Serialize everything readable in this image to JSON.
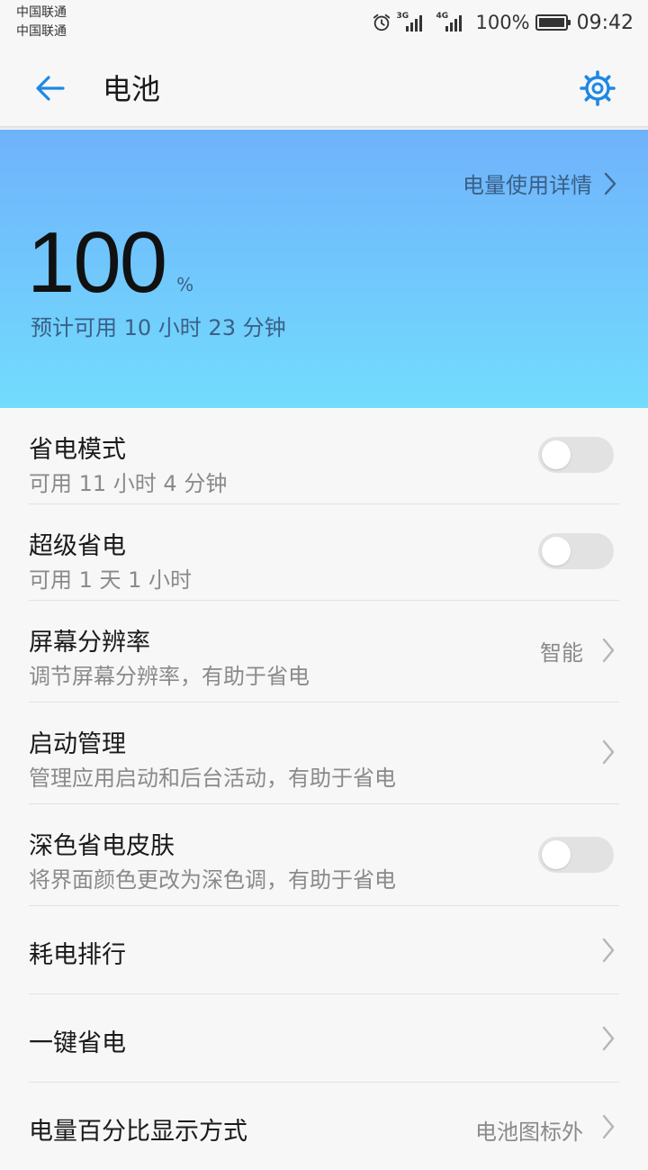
{
  "status_bar": {
    "carrier1": "中国联通",
    "carrier2": "中国联通",
    "alarm_icon": "alarm-clock-icon",
    "network1": "3G",
    "network2": "4G",
    "battery_percent": "100%",
    "battery_level": 1.0,
    "time": "09:42"
  },
  "header": {
    "title": "电池",
    "back_icon": "arrow-left-icon",
    "settings_icon": "gear-icon"
  },
  "hero": {
    "usage_link": "电量使用详情",
    "level": "100",
    "unit": "%",
    "estimate": "预计可用 10 小时 23 分钟",
    "gradient_top": "#6fb2fb",
    "gradient_bottom": "#72dcfd"
  },
  "settings": [
    {
      "title": "省电模式",
      "subtitle": "可用 11 小时 4 分钟",
      "control": "toggle",
      "on": false
    },
    {
      "title": "超级省电",
      "subtitle": "可用 1 天 1 小时",
      "control": "toggle",
      "on": false
    },
    {
      "title": "屏幕分辨率",
      "subtitle": "调节屏幕分辨率，有助于省电",
      "control": "chevron",
      "value": "智能"
    },
    {
      "title": "启动管理",
      "subtitle": "管理应用启动和后台活动，有助于省电",
      "control": "chevron"
    },
    {
      "title": "深色省电皮肤",
      "subtitle": "将界面颜色更改为深色调，有助于省电",
      "control": "toggle",
      "on": false
    },
    {
      "title": "耗电排行",
      "control": "chevron"
    },
    {
      "title": "一键省电",
      "control": "chevron"
    },
    {
      "title": "电量百分比显示方式",
      "control": "chevron",
      "value": "电池图标外"
    }
  ],
  "colors": {
    "accent": "#1e88e5",
    "background": "#f7f7f7",
    "toggle_off": "#e2e2e2"
  }
}
